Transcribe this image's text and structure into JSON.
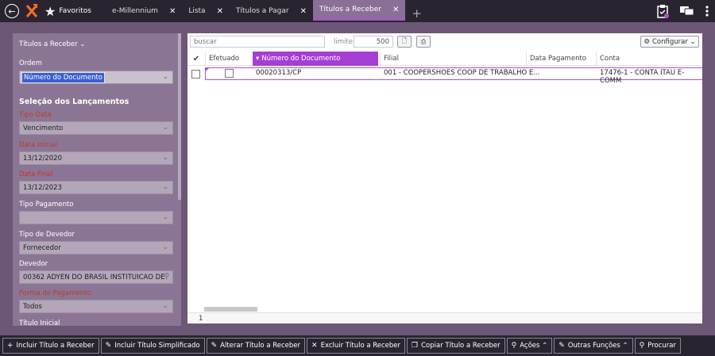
{
  "topbar": {
    "favorites_label": "Favoritos",
    "tabs": [
      {
        "label": "e-Millennium",
        "close": "✕",
        "active": false
      },
      {
        "label": "Lista",
        "close": "✕",
        "active": false
      },
      {
        "label": "Títulos a Pagar",
        "close": "✕",
        "active": false
      },
      {
        "label": "Títulos a Receber",
        "close": "✕",
        "active": true
      }
    ],
    "add_tab": "+"
  },
  "filters": {
    "panel_title": "Títulos a Receber ⌄",
    "ordem_label": "Ordem",
    "ordem_value": "Número do Documento",
    "section_title": "Seleção dos Lançamentos",
    "tipo_data_label": "Tipo Data",
    "tipo_data_value": "Vencimento",
    "data_inicial_label": "Data Inicial",
    "data_inicial_value": "13/12/2020",
    "data_final_label": "Data Final",
    "data_final_value": "13/12/2023",
    "tipo_pagamento_label": "Tipo Pagamento",
    "tipo_pagamento_value": "",
    "tipo_devedor_label": "Tipo de Devedor",
    "tipo_devedor_value": "Fornecedor",
    "devedor_label": "Devedor",
    "devedor_value": "00362 ADYEN DO BRASIL INSTITUICAO DE",
    "forma_pagamento_label": "Forma de Pagamento",
    "forma_pagamento_value": "Todos",
    "titulo_inicial_label": "Título Inicial"
  },
  "grid": {
    "search_placeholder": "buscar",
    "limite_label": "limite:",
    "limite_value": "500",
    "configurar_label": "Configurar ⌄",
    "columns": {
      "check": "✔",
      "efetuado": "Efetuado",
      "numero": "Número do Documento",
      "filial": "Filial",
      "data_pagamento": "Data Pagamento",
      "conta": "Conta"
    },
    "rows": [
      {
        "numero": "00020313/CP",
        "filial": "001 - COOPERSHOES COOP DE TRABALHO E...",
        "data_pagamento": "",
        "conta": "17476-1 - CONTA ITAU E-COMM"
      }
    ],
    "record_count": "1"
  },
  "actions": [
    {
      "icon": "+",
      "label": "Incluir Título a Receber"
    },
    {
      "icon": "✎",
      "label": "Incluir Título Simplificado"
    },
    {
      "icon": "✎",
      "label": "Alterar Título a Receber"
    },
    {
      "icon": "✕",
      "label": "Excluir Título a Receber"
    },
    {
      "icon": "❐",
      "label": "Copiar Título a Receber"
    },
    {
      "icon": "⚲",
      "label": "Ações ⌃"
    },
    {
      "icon": "✎",
      "label": "Outras Funções ⌃"
    },
    {
      "icon": "⚲",
      "label": "Procurar"
    }
  ],
  "colors": {
    "accent": "#a53ed3",
    "topbar": "#2a2431",
    "background": "#6c5777"
  }
}
